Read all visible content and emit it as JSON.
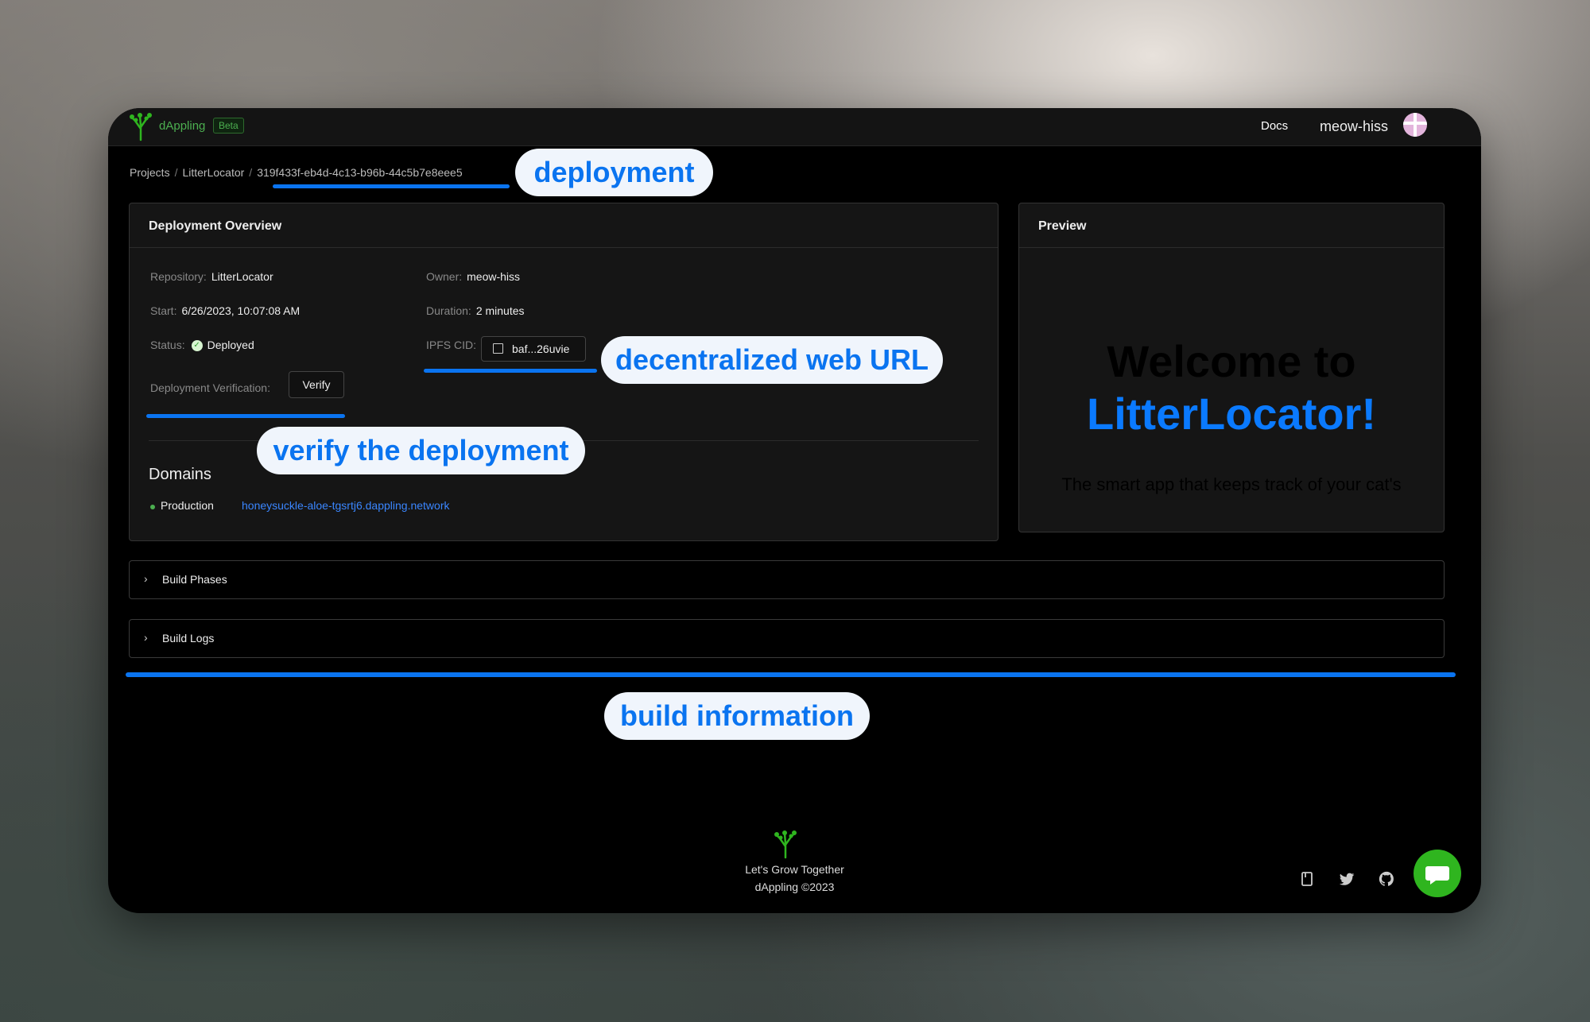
{
  "header": {
    "brand": "dAppling",
    "badge": "Beta",
    "docs_label": "Docs",
    "username": "meow-hiss"
  },
  "breadcrumb": {
    "projects": "Projects",
    "project": "LitterLocator",
    "deployment_id": "319f433f-eb4d-4c13-b96b-44c5b7e8eee5"
  },
  "overview": {
    "title": "Deployment Overview",
    "repository_label": "Repository",
    "repository": "LitterLocator",
    "owner_label": "Owner",
    "owner": "meow-hiss",
    "start_label": "Start",
    "start": "6/26/2023, 10:07:08 AM",
    "duration_label": "Duration",
    "duration": "2 minutes",
    "status_label": "Status",
    "status": "Deployed",
    "ipfs_label": "IPFS CID",
    "ipfs_cid": "baf...26uvie",
    "verification_label": "Deployment Verification",
    "verify_button": "Verify",
    "domains_title": "Domains",
    "production_label": "Production",
    "production_url": "honeysuckle-aloe-tgsrtj6.dappling.network"
  },
  "preview": {
    "title": "Preview",
    "welcome_line": "Welcome to",
    "app_name": "LitterLocator!",
    "subtitle": "The smart app that keeps track of your cat's"
  },
  "sections": {
    "build_phases": "Build Phases",
    "build_logs": "Build Logs"
  },
  "callouts": {
    "deployment": "deployment",
    "web_url": "decentralized web URL",
    "verify": "verify the deployment",
    "build_info": "build information"
  },
  "footer": {
    "tagline": "Let's Grow Together",
    "copyright": "dAppling ©2023"
  },
  "icons": {
    "brand_color": "#4caf50",
    "accent": "#0a74f0",
    "chat": "chat-bubble-icon",
    "docs": "book-icon",
    "twitter": "twitter-icon",
    "github": "github-icon"
  }
}
